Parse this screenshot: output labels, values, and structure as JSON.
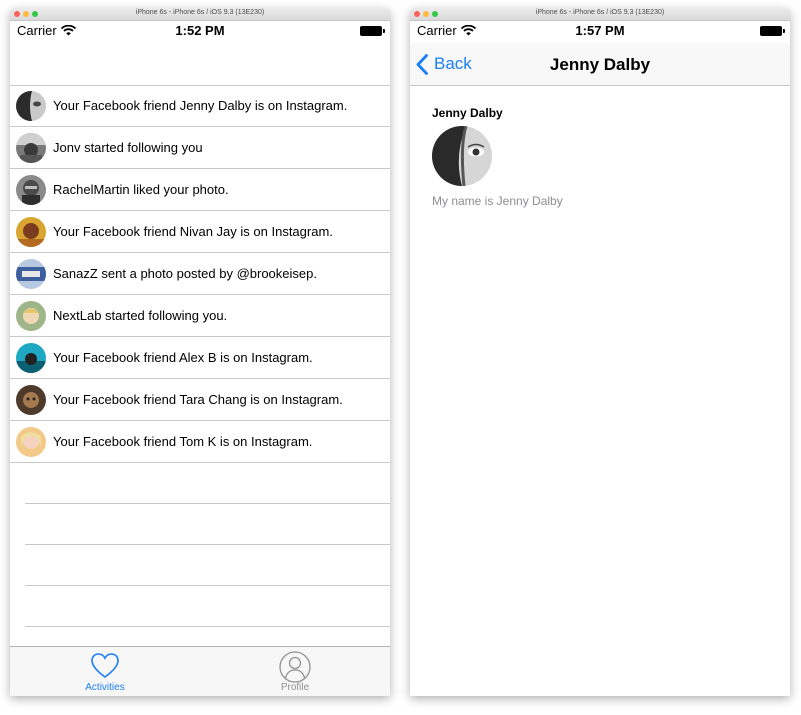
{
  "left": {
    "sim_title": "iPhone 6s - iPhone 6s / iOS 9.3 (13E230)",
    "status": {
      "carrier": "Carrier",
      "time": "1:52 PM"
    },
    "feed": [
      "Your Facebook friend Jenny Dalby is on Instagram.",
      "Jonv started following you",
      "RachelMartin liked your photo.",
      "Your Facebook friend Nivan Jay is on Instagram.",
      "SanazZ sent a photo posted by @brookeisep.",
      "NextLab started following you.",
      "Your Facebook friend Alex B is on Instagram.",
      "Your Facebook friend Tara Chang is on Instagram.",
      "Your Facebook friend Tom K is on Instagram."
    ],
    "tabs": {
      "activities": "Activities",
      "profile": "Profile"
    }
  },
  "right": {
    "sim_title": "iPhone 6s - iPhone 6s / iOS 9.3 (13E230)",
    "status": {
      "carrier": "Carrier",
      "time": "1:57 PM"
    },
    "nav": {
      "back_label": "Back",
      "title": "Jenny Dalby"
    },
    "profile": {
      "name": "Jenny Dalby",
      "bio": "My name is Jenny Dalby"
    }
  },
  "colors": {
    "tint": "#1a7ff6",
    "inactive": "#929292",
    "separator": "#c8c7cc"
  },
  "icons": {
    "wifi": "wifi-icon",
    "battery": "battery-icon",
    "back": "chevron-left-icon",
    "activities": "heart-icon",
    "profile": "person-circle-icon"
  }
}
